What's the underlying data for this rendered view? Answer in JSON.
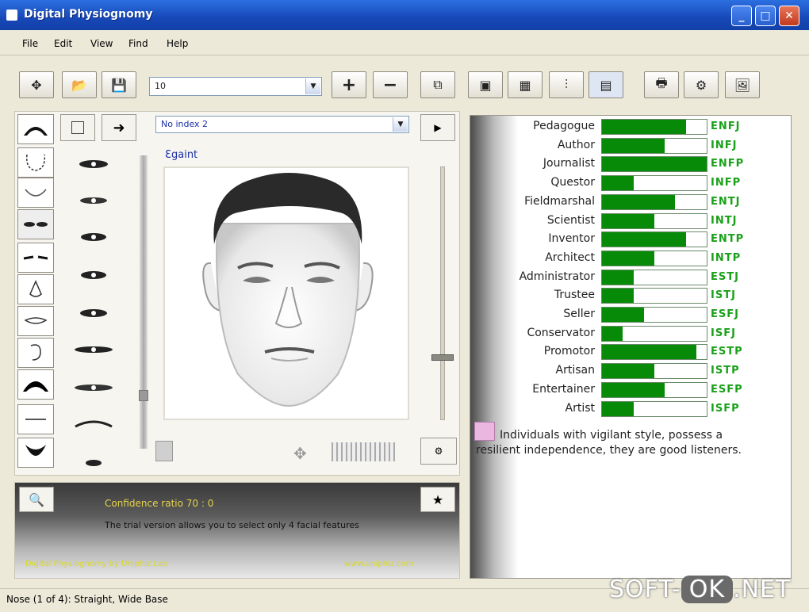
{
  "window": {
    "title": "Digital Physiognomy"
  },
  "menu": [
    "File",
    "Edit",
    "View",
    "Find",
    "Help"
  ],
  "toolbar": {
    "number_select": "10",
    "plus": "+",
    "minus": "−"
  },
  "feature_panel": {
    "index_select": "No index 2",
    "canvas_label": "Ɛgaint",
    "play": "▶"
  },
  "bottom_panel": {
    "heading": "Confidence ratio    70 : 0",
    "message": "The trial version allows you to select only 4 facial features",
    "footer_left": "Digital Physiognomy by Uniphiz Lab",
    "footer_right": "www.uniphiz.com"
  },
  "types": [
    {
      "label": "Pedagogue",
      "code": "ENFJ",
      "value": 0.8
    },
    {
      "label": "Author",
      "code": "INFJ",
      "value": 0.6
    },
    {
      "label": "Journalist",
      "code": "ENFP",
      "value": 1.0
    },
    {
      "label": "Questor",
      "code": "INFP",
      "value": 0.3
    },
    {
      "label": "Fieldmarshal",
      "code": "ENTJ",
      "value": 0.7
    },
    {
      "label": "Scientist",
      "code": "INTJ",
      "value": 0.5
    },
    {
      "label": "Inventor",
      "code": "ENTP",
      "value": 0.8
    },
    {
      "label": "Architect",
      "code": "INTP",
      "value": 0.5
    },
    {
      "label": "Administrator",
      "code": "ESTJ",
      "value": 0.3
    },
    {
      "label": "Trustee",
      "code": "ISTJ",
      "value": 0.3
    },
    {
      "label": "Seller",
      "code": "ESFJ",
      "value": 0.4
    },
    {
      "label": "Conservator",
      "code": "ISFJ",
      "value": 0.2
    },
    {
      "label": "Promotor",
      "code": "ESTP",
      "value": 0.9
    },
    {
      "label": "Artisan",
      "code": "ISTP",
      "value": 0.5
    },
    {
      "label": "Entertainer",
      "code": "ESFP",
      "value": 0.6
    },
    {
      "label": "Artist",
      "code": "ISFP",
      "value": 0.3
    }
  ],
  "description": "Individuals with vigilant style, possess a resilient independence, they are good listeners.",
  "status": "Nose (1 of 4): Straight, Wide Base",
  "watermark": {
    "left": "SOFT-",
    "ok": "OK",
    "right": ".NET"
  }
}
